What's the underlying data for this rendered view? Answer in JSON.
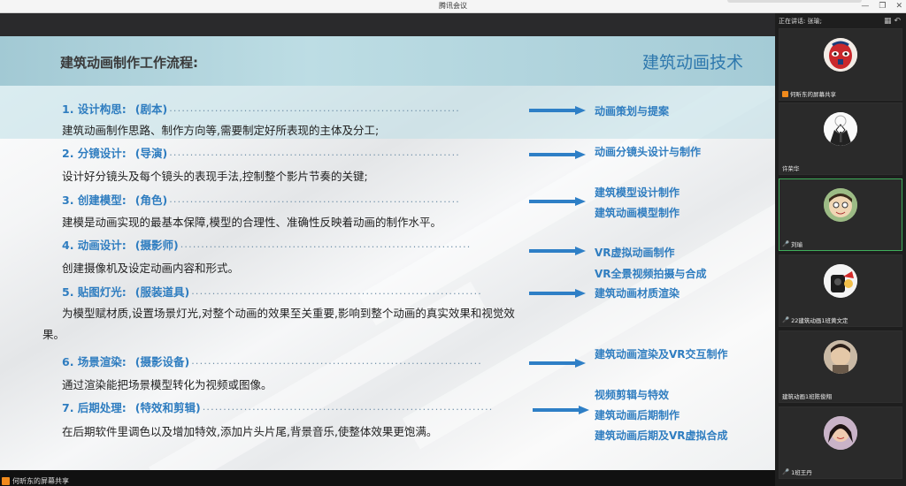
{
  "window": {
    "title": "腾讯会议",
    "minimize": "—",
    "restore": "❐",
    "close": "✕"
  },
  "slide": {
    "title": "建筑动画制作工作流程:",
    "brand": "建筑动画技术",
    "steps": [
      {
        "title": "1. 设计构思:",
        "role": "(剧本)",
        "desc": "建筑动画制作思路、制作方向等,需要制定好所表现的主体及分工;"
      },
      {
        "title": "2. 分镜设计:",
        "role": "(导演)",
        "desc": "设计好分镜头及每个镜头的表现手法,控制整个影片节奏的关键;"
      },
      {
        "title": "3. 创建模型:",
        "role": "(角色)",
        "desc": "建模是动画实现的最基本保障,模型的合理性、准确性反映着动画的制作水平。"
      },
      {
        "title": "4. 动画设计:",
        "role": "(摄影师)",
        "desc": "创建摄像机及设定动画内容和形式。"
      },
      {
        "title": "5. 贴图灯光:",
        "role": "(服装道具)",
        "desc": "为模型赋材质,设置场景灯光,对整个动画的效果至关重要,影响到整个动画的真实效果和视觉效果。"
      },
      {
        "title": "6. 场景渲染:",
        "role": "(摄影设备)",
        "desc": "通过渲染能把场景模型转化为视频或图像。"
      },
      {
        "title": "7. 后期处理:",
        "role": "(特效和剪辑)",
        "desc": "在后期软件里调色以及增加特效,添加片头片尾,背景音乐,使整体效果更饱满。"
      }
    ],
    "outputs": [
      "动画策划与提案",
      "动画分镜头设计与制作",
      "建筑模型设计制作",
      "建筑动画模型制作",
      "VR虚拟动画制作",
      "VR全景视频拍摄与合成",
      "建筑动画材质渲染",
      "建筑动画渲染及VR交互制作",
      "视频剪辑与特效",
      "建筑动画后期制作",
      "建筑动画后期及VR虚拟合成"
    ]
  },
  "share_label": "何昕东的屏幕共享",
  "sidebar": {
    "speaking": "正在讲话: 张瑜;",
    "participants": [
      {
        "name": "何昕东的屏幕共享"
      },
      {
        "name": "许荣华"
      },
      {
        "name": "刘瑜"
      },
      {
        "name": "22建筑动画1班黄文定"
      },
      {
        "name": "建筑动画1班陈俊翔"
      },
      {
        "name": "1班王丹"
      }
    ]
  },
  "colors": {
    "accent": "#2f7dc0",
    "arrow": "#2e7fc6",
    "header": "#a8cfd9",
    "active_tile": "#3fae5b"
  }
}
